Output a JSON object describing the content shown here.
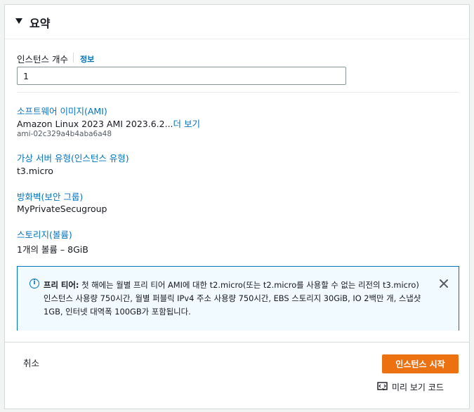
{
  "summary": {
    "title": "요약",
    "instance_count": {
      "label": "인스턴스 개수",
      "info_link": "정보",
      "value": "1"
    },
    "software_image": {
      "heading": "소프트웨어 이미지(AMI)",
      "value": "Amazon Linux 2023 AMI 2023.6.2...",
      "more_link": "더 보기",
      "ami_id": "ami-02c329a4b4aba6a48"
    },
    "instance_type": {
      "heading": "가상 서버 유형(인스턴스 유형)",
      "value": "t3.micro"
    },
    "firewall": {
      "heading": "방화벽(보안 그룹)",
      "value": "MyPrivateSecugroup"
    },
    "storage": {
      "heading": "스토리지(볼륨)",
      "value": "1개의 볼륨 – 8GiB"
    },
    "free_tier_alert": {
      "title": "프리 티어:",
      "message": "첫 해에는 월별 프리 티어 AMI에 대한 t2.micro(또는 t2.micro를 사용할 수 없는 리전의 t3.micro) 인스턴스 사용량 750시간, 월별 퍼블릭 IPv4 주소 사용량 750시간, EBS 스토리지 30GiB, IO 2백만 개, 스냅샷 1GB, 인터넷 대역폭 100GB가 포함됩니다."
    }
  },
  "footer": {
    "cancel_label": "취소",
    "launch_label": "인스턴스 시작",
    "preview_code_label": "미리 보기 코드"
  },
  "colors": {
    "link": "#0073bb",
    "primary_button": "#ec7211",
    "alert_background": "#f1faff",
    "alert_border": "#0073bb"
  }
}
